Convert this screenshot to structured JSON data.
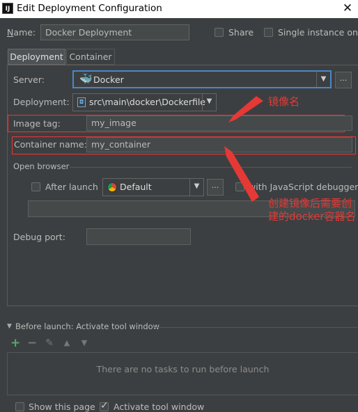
{
  "window": {
    "app_icon": "IJ",
    "title": "Edit Deployment Configuration",
    "close": "✕"
  },
  "name": {
    "label": "Name:",
    "value": "Docker Deployment"
  },
  "share": {
    "label": "Share",
    "checked": false
  },
  "single_instance": {
    "label": "Single instance only",
    "checked": false
  },
  "tabs": [
    {
      "label": "Deployment",
      "active": true
    },
    {
      "label": "Container",
      "active": false
    }
  ],
  "server": {
    "label": "Server:",
    "value": "Docker",
    "icon": "docker-icon",
    "more": "..."
  },
  "deployment": {
    "label": "Deployment:",
    "value": "src\\main\\docker\\Dockerfile",
    "icon": "dockerfile-icon"
  },
  "image_tag": {
    "label": "Image tag:",
    "value": "my_image"
  },
  "container_name": {
    "label": "Container name:",
    "value": "my_container"
  },
  "open_browser": {
    "label": "Open browser",
    "after_launch": {
      "label": "After launch",
      "checked": false
    },
    "browser": {
      "value": "Default",
      "icon": "chrome-icon",
      "more": "..."
    },
    "js_debugger": {
      "label": "with JavaScript debugger",
      "checked": false
    },
    "url": ""
  },
  "debug_port": {
    "label": "Debug port:",
    "value": ""
  },
  "annotations": {
    "image_name": "镜像名",
    "container_name_line1": "创建镜像后需要创",
    "container_name_line2": "建的docker容器名"
  },
  "before_launch": {
    "label": "Before launch: Activate tool window",
    "toolbar": [
      "add-icon",
      "remove-icon",
      "edit-icon",
      "move-up-icon",
      "move-down-icon"
    ],
    "empty_text": "There are no tasks to run before launch"
  },
  "footer": {
    "show_this_page": {
      "label": "Show this page",
      "checked": false
    },
    "activate_tool_window": {
      "label": "Activate tool window",
      "checked": true
    }
  },
  "colors": {
    "background": "#3c3f41",
    "field": "#45494a",
    "annotation": "#e53935",
    "add": "#59a869"
  }
}
